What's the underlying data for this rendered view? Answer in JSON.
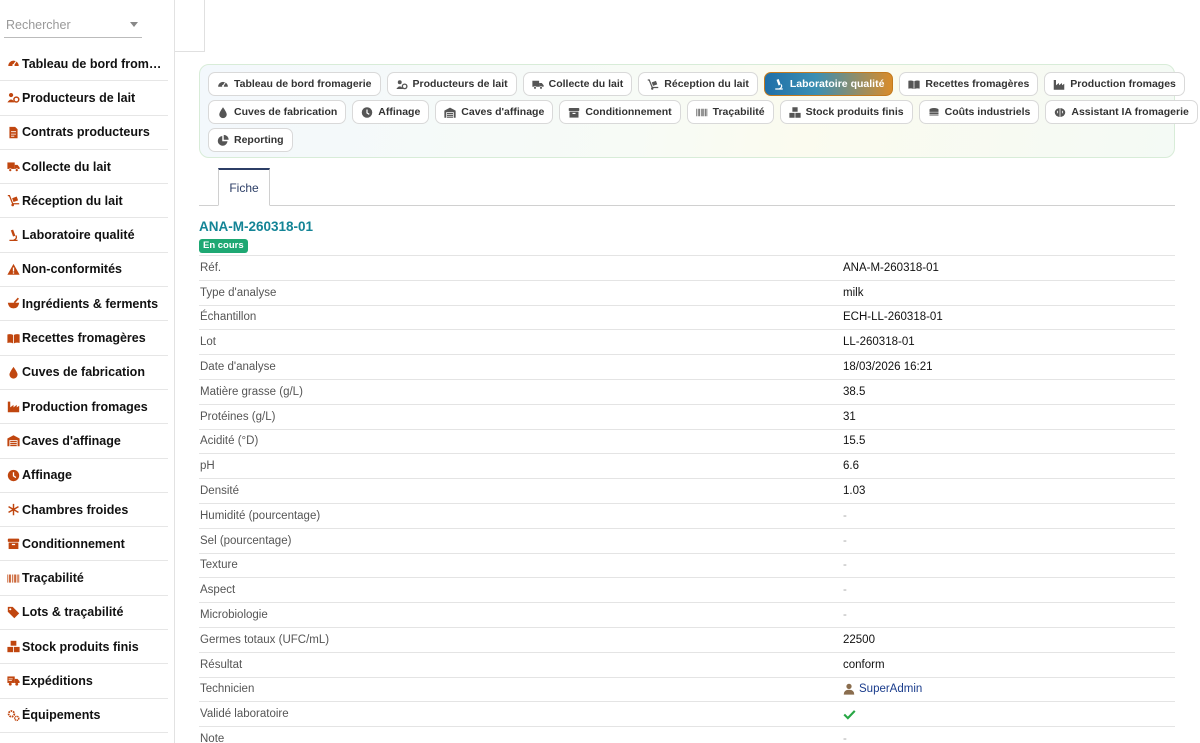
{
  "search": {
    "placeholder": "Rechercher"
  },
  "sidebar": {
    "items": [
      {
        "label": "Tableau de bord fromagerie",
        "icon": "gauge-icon"
      },
      {
        "label": "Producteurs de lait",
        "icon": "users-cog-icon"
      },
      {
        "label": "Contrats producteurs",
        "icon": "contract-icon"
      },
      {
        "label": "Collecte du lait",
        "icon": "truck-icon"
      },
      {
        "label": "Réception du lait",
        "icon": "dolly-icon"
      },
      {
        "label": "Laboratoire qualité",
        "icon": "microscope-icon"
      },
      {
        "label": "Non-conformités",
        "icon": "warning-icon"
      },
      {
        "label": "Ingrédients & ferments",
        "icon": "mortar-icon"
      },
      {
        "label": "Recettes fromagères",
        "icon": "book-open-icon"
      },
      {
        "label": "Cuves de fabrication",
        "icon": "droplet-icon"
      },
      {
        "label": "Production fromages",
        "icon": "industry-icon"
      },
      {
        "label": "Caves d'affinage",
        "icon": "warehouse-icon"
      },
      {
        "label": "Affinage",
        "icon": "clock-icon"
      },
      {
        "label": "Chambres froides",
        "icon": "snowflake-icon"
      },
      {
        "label": "Conditionnement",
        "icon": "box-icon"
      },
      {
        "label": "Traçabilité",
        "icon": "barcode-icon"
      },
      {
        "label": "Lots & traçabilité",
        "icon": "tags-icon"
      },
      {
        "label": "Stock produits finis",
        "icon": "boxes-icon"
      },
      {
        "label": "Expéditions",
        "icon": "shipping-icon"
      },
      {
        "label": "Équipements",
        "icon": "cogs-icon"
      }
    ]
  },
  "modules": {
    "rows": [
      [
        {
          "label": "Tableau de bord fromagerie",
          "icon": "gauge-icon",
          "active": false
        },
        {
          "label": "Producteurs de lait",
          "icon": "users-cog-icon",
          "active": false
        },
        {
          "label": "Collecte du lait",
          "icon": "truck-icon",
          "active": false
        },
        {
          "label": "Réception du lait",
          "icon": "dolly-icon",
          "active": false
        },
        {
          "label": "Laboratoire qualité",
          "icon": "microscope-icon",
          "active": true
        },
        {
          "label": "Recettes fromagères",
          "icon": "book-open-icon",
          "active": false
        },
        {
          "label": "Production fromages",
          "icon": "industry-icon",
          "active": false
        }
      ],
      [
        {
          "label": "Cuves de fabrication",
          "icon": "droplet-icon",
          "active": false
        },
        {
          "label": "Affinage",
          "icon": "clock-icon",
          "active": false
        },
        {
          "label": "Caves d'affinage",
          "icon": "warehouse-icon",
          "active": false
        },
        {
          "label": "Conditionnement",
          "icon": "box-icon",
          "active": false
        },
        {
          "label": "Traçabilité",
          "icon": "barcode-icon",
          "active": false
        },
        {
          "label": "Stock produits finis",
          "icon": "boxes-icon",
          "active": false
        },
        {
          "label": "Coûts industriels",
          "icon": "coins-icon",
          "active": false
        },
        {
          "label": "Assistant IA fromagerie",
          "icon": "brain-icon",
          "active": false
        }
      ],
      [
        {
          "label": "Reporting",
          "icon": "chart-pie-icon",
          "active": false
        }
      ]
    ]
  },
  "tabs": {
    "fiche": "Fiche"
  },
  "record": {
    "title": "ANA-M-260318-01",
    "status": "En cours",
    "fields": [
      {
        "label": "Réf.",
        "value": "ANA-M-260318-01"
      },
      {
        "label": "Type d'analyse",
        "value": "milk"
      },
      {
        "label": "Échantillon",
        "value": "ECH-LL-260318-01"
      },
      {
        "label": "Lot",
        "value": "LL-260318-01"
      },
      {
        "label": "Date d'analyse",
        "value": "18/03/2026 16:21"
      },
      {
        "label": "Matière grasse (g/L)",
        "value": "38.5"
      },
      {
        "label": "Protéines (g/L)",
        "value": "31"
      },
      {
        "label": "Acidité (°D)",
        "value": "15.5"
      },
      {
        "label": "pH",
        "value": "6.6"
      },
      {
        "label": "Densité",
        "value": "1.03"
      },
      {
        "label": "Humidité (pourcentage)",
        "value": "-"
      },
      {
        "label": "Sel (pourcentage)",
        "value": "-"
      },
      {
        "label": "Texture",
        "value": "-"
      },
      {
        "label": "Aspect",
        "value": "-"
      },
      {
        "label": "Microbiologie",
        "value": "-"
      },
      {
        "label": "Germes totaux (UFC/mL)",
        "value": "22500"
      },
      {
        "label": "Résultat",
        "value": "conform"
      },
      {
        "label": "Technicien",
        "value": "SuperAdmin",
        "type": "user"
      },
      {
        "label": "Validé laboratoire",
        "value": "",
        "type": "check"
      },
      {
        "label": "Note",
        "value": "-"
      }
    ]
  },
  "colors": {
    "icon_orange": "#c0460f",
    "title_teal": "#138496",
    "badge_green": "#1ea873",
    "check_green": "#28a745",
    "link_blue": "#1a3c8c"
  }
}
